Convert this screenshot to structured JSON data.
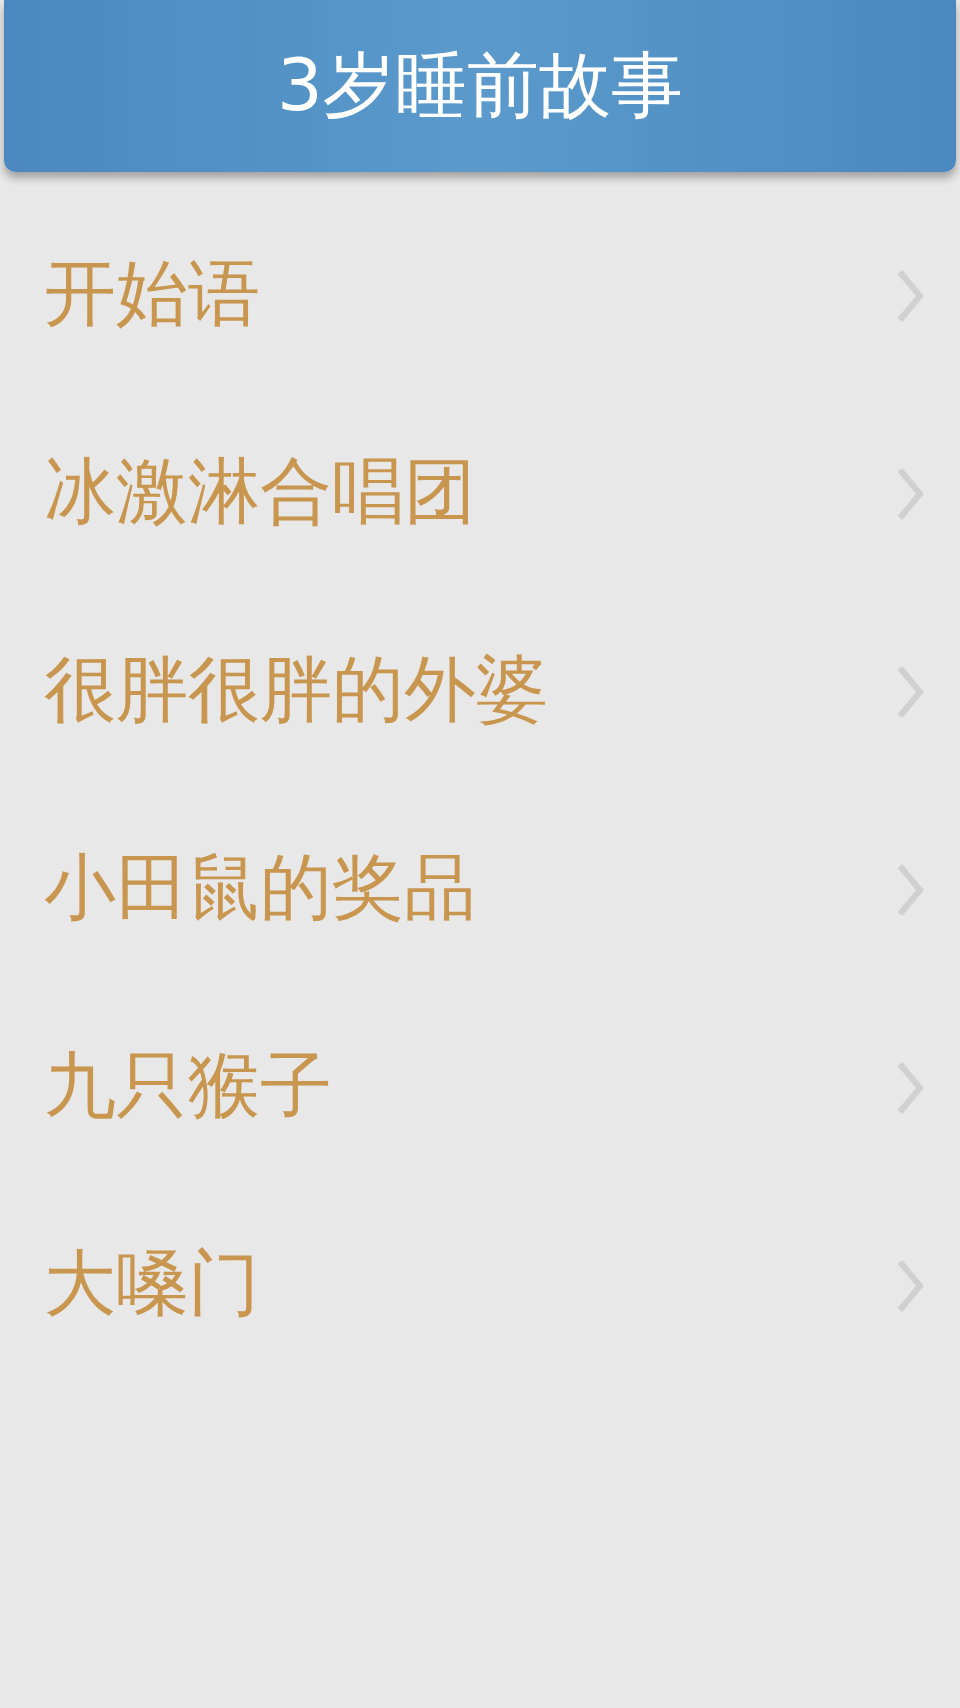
{
  "header": {
    "title": "3岁睡前故事"
  },
  "stories": [
    {
      "title": "开始语"
    },
    {
      "title": "冰激淋合唱团"
    },
    {
      "title": "很胖很胖的外婆"
    },
    {
      "title": "小田鼠的奖品"
    },
    {
      "title": "九只猴子"
    },
    {
      "title": "大嗓门"
    }
  ]
}
